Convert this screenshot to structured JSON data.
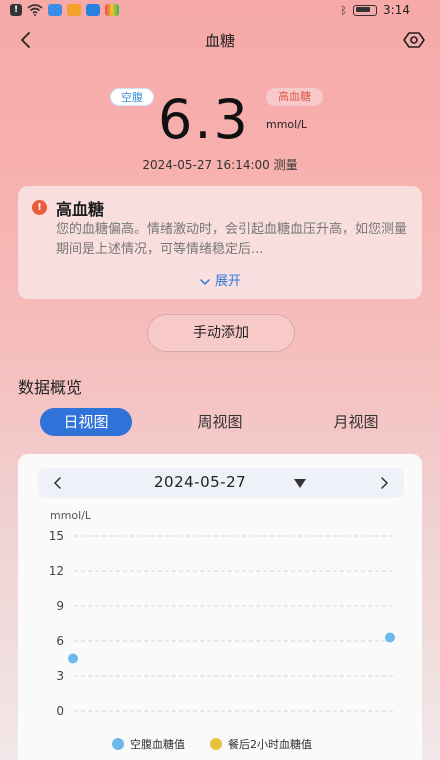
{
  "status_bar": {
    "time": "3:14"
  },
  "nav": {
    "title": "血糖"
  },
  "reading": {
    "tag_fasting": "空腹",
    "tag_level": "高血糖",
    "value": "6.3",
    "unit": "mmol/L",
    "measured_at": "2024-05-27 16:14:00 测量"
  },
  "alert": {
    "title": "高血糖",
    "text": "您的血糖偏高。情绪激动时，会引起血糖血压升高，如您测量期间是上述情况，可等情绪稳定后...",
    "expand_label": "展开"
  },
  "manual_add_label": "手动添加",
  "section_title": "数据概览",
  "tabs": {
    "day": "日视图",
    "week": "周视图",
    "month": "月视图"
  },
  "date_selector": {
    "date": "2024-05-27"
  },
  "chart_data": {
    "type": "scatter",
    "ylabel": "mmol/L",
    "y_ticks": [
      15,
      12,
      9,
      6,
      3,
      0
    ],
    "ylim": [
      0,
      15
    ],
    "grid": true,
    "legend_position": "bottom",
    "series": [
      {
        "name": "空腹血糖值",
        "color": "#6bb9ea",
        "values": [
          4.5,
          6.3
        ]
      },
      {
        "name": "餐后2小时血糖值",
        "color": "#e8c23a",
        "values": []
      }
    ]
  },
  "colors": {
    "accent": "#2f72d8",
    "warning": "#ea5a3d",
    "high_text": "#e2574c"
  }
}
